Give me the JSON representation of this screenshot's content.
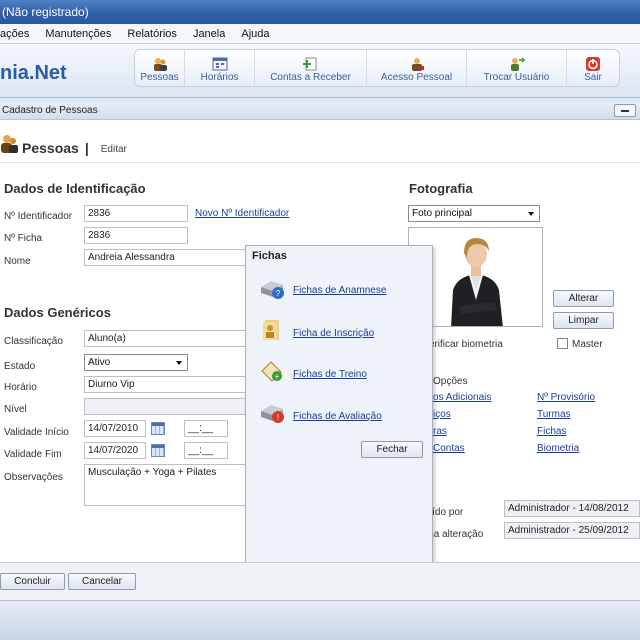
{
  "window": {
    "title": "(Não registrado)"
  },
  "menu": {
    "items": [
      "ações",
      "Manutenções",
      "Relatórios",
      "Janela",
      "Ajuda"
    ]
  },
  "app": {
    "brand": "nia.Net"
  },
  "toolbar": {
    "buttons": [
      "Pessoas",
      "Horários",
      "Contas a Receber",
      "Acesso Pessoal",
      "Trocar Usuário",
      "Sair"
    ]
  },
  "panel": {
    "title": "Cadastro de Pessoas"
  },
  "page": {
    "title": "Pessoas",
    "separator": "|",
    "subtitle": "Editar"
  },
  "identificacao": {
    "heading": "Dados de Identificação",
    "id_label": "Nº Identificador",
    "id_value": "2836",
    "novo_id_link": "Novo Nº Identificador",
    "ficha_label": "Nº Ficha",
    "ficha_value": "2836",
    "nome_label": "Nome",
    "nome_value": "Andreia Alessandra"
  },
  "genericos": {
    "heading": "Dados Genéricos",
    "classificacao_label": "Classificação",
    "classificacao_value": "Aluno(a)",
    "estado_label": "Estado",
    "estado_value": "Ativo",
    "horario_label": "Horário",
    "horario_value": "Diurno Vip",
    "nivel_label": "Nível",
    "nivel_value": "",
    "inicio_label": "Validade Início",
    "inicio_date": "14/07/2010",
    "inicio_time": "__:__",
    "fim_label": "Validade Fim",
    "fim_date": "14/07/2020",
    "fim_time": "__:__",
    "obs_label": "Observações",
    "obs_value": "Musculação + Yoga + Pilates"
  },
  "fotografia": {
    "heading": "Fotografia",
    "select_value": "Foto principal",
    "alterar": "Alterar",
    "limpar": "Limpar",
    "biometria_label": "ão verificar biometria",
    "master_label": "Master"
  },
  "opcoes": {
    "heading": "Opções",
    "links_left": [
      "os Adicionais",
      "iços",
      "ras",
      "Contas"
    ],
    "links_right": [
      "Nº Provisório",
      "Turmas",
      "Fichas",
      "Biometria"
    ]
  },
  "audit": {
    "incluido_label": "Incluído por",
    "incluido_value": "Administrador - 14/08/2012",
    "alteracao_label": "Última alteração",
    "alteracao_value": "Administrador - 25/09/2012"
  },
  "fichas_popup": {
    "title": "Fichas",
    "items": [
      "Fichas de Anamnese",
      "Ficha de Inscrição",
      "Fichas de Treino",
      "Fichas de Avaliação"
    ],
    "close": "Fechar"
  },
  "actions": {
    "concluir": "Concluir",
    "cancelar": "Cancelar"
  }
}
